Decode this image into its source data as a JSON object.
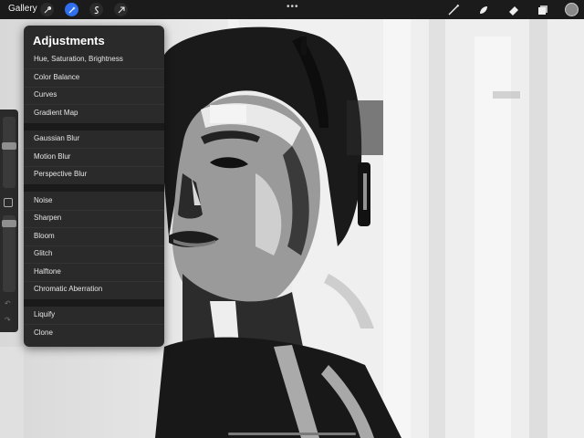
{
  "app": {
    "gallery_label": "Gallery"
  },
  "topbar": {
    "more_dots": "•••"
  },
  "menu": {
    "title": "Adjustments",
    "groups": [
      [
        "Hue, Saturation, Brightness",
        "Color Balance",
        "Curves",
        "Gradient Map"
      ],
      [
        "Gaussian Blur",
        "Motion Blur",
        "Perspective Blur"
      ],
      [
        "Noise",
        "Sharpen",
        "Bloom",
        "Glitch",
        "Halftone",
        "Chromatic Aberration"
      ],
      [
        "Liquify",
        "Clone"
      ]
    ]
  },
  "icons": {
    "left_tools": [
      "wrench-icon",
      "magic-wand-icon",
      "selection-s-icon",
      "transform-arrow-icon"
    ],
    "right_tools": [
      "brush-icon",
      "smudge-icon",
      "eraser-icon",
      "layers-icon",
      "color-swatch"
    ]
  },
  "colors": {
    "accent": "#2f6fed",
    "menu_bg": "#222222",
    "topbar_bg": "#1b1b1b"
  }
}
